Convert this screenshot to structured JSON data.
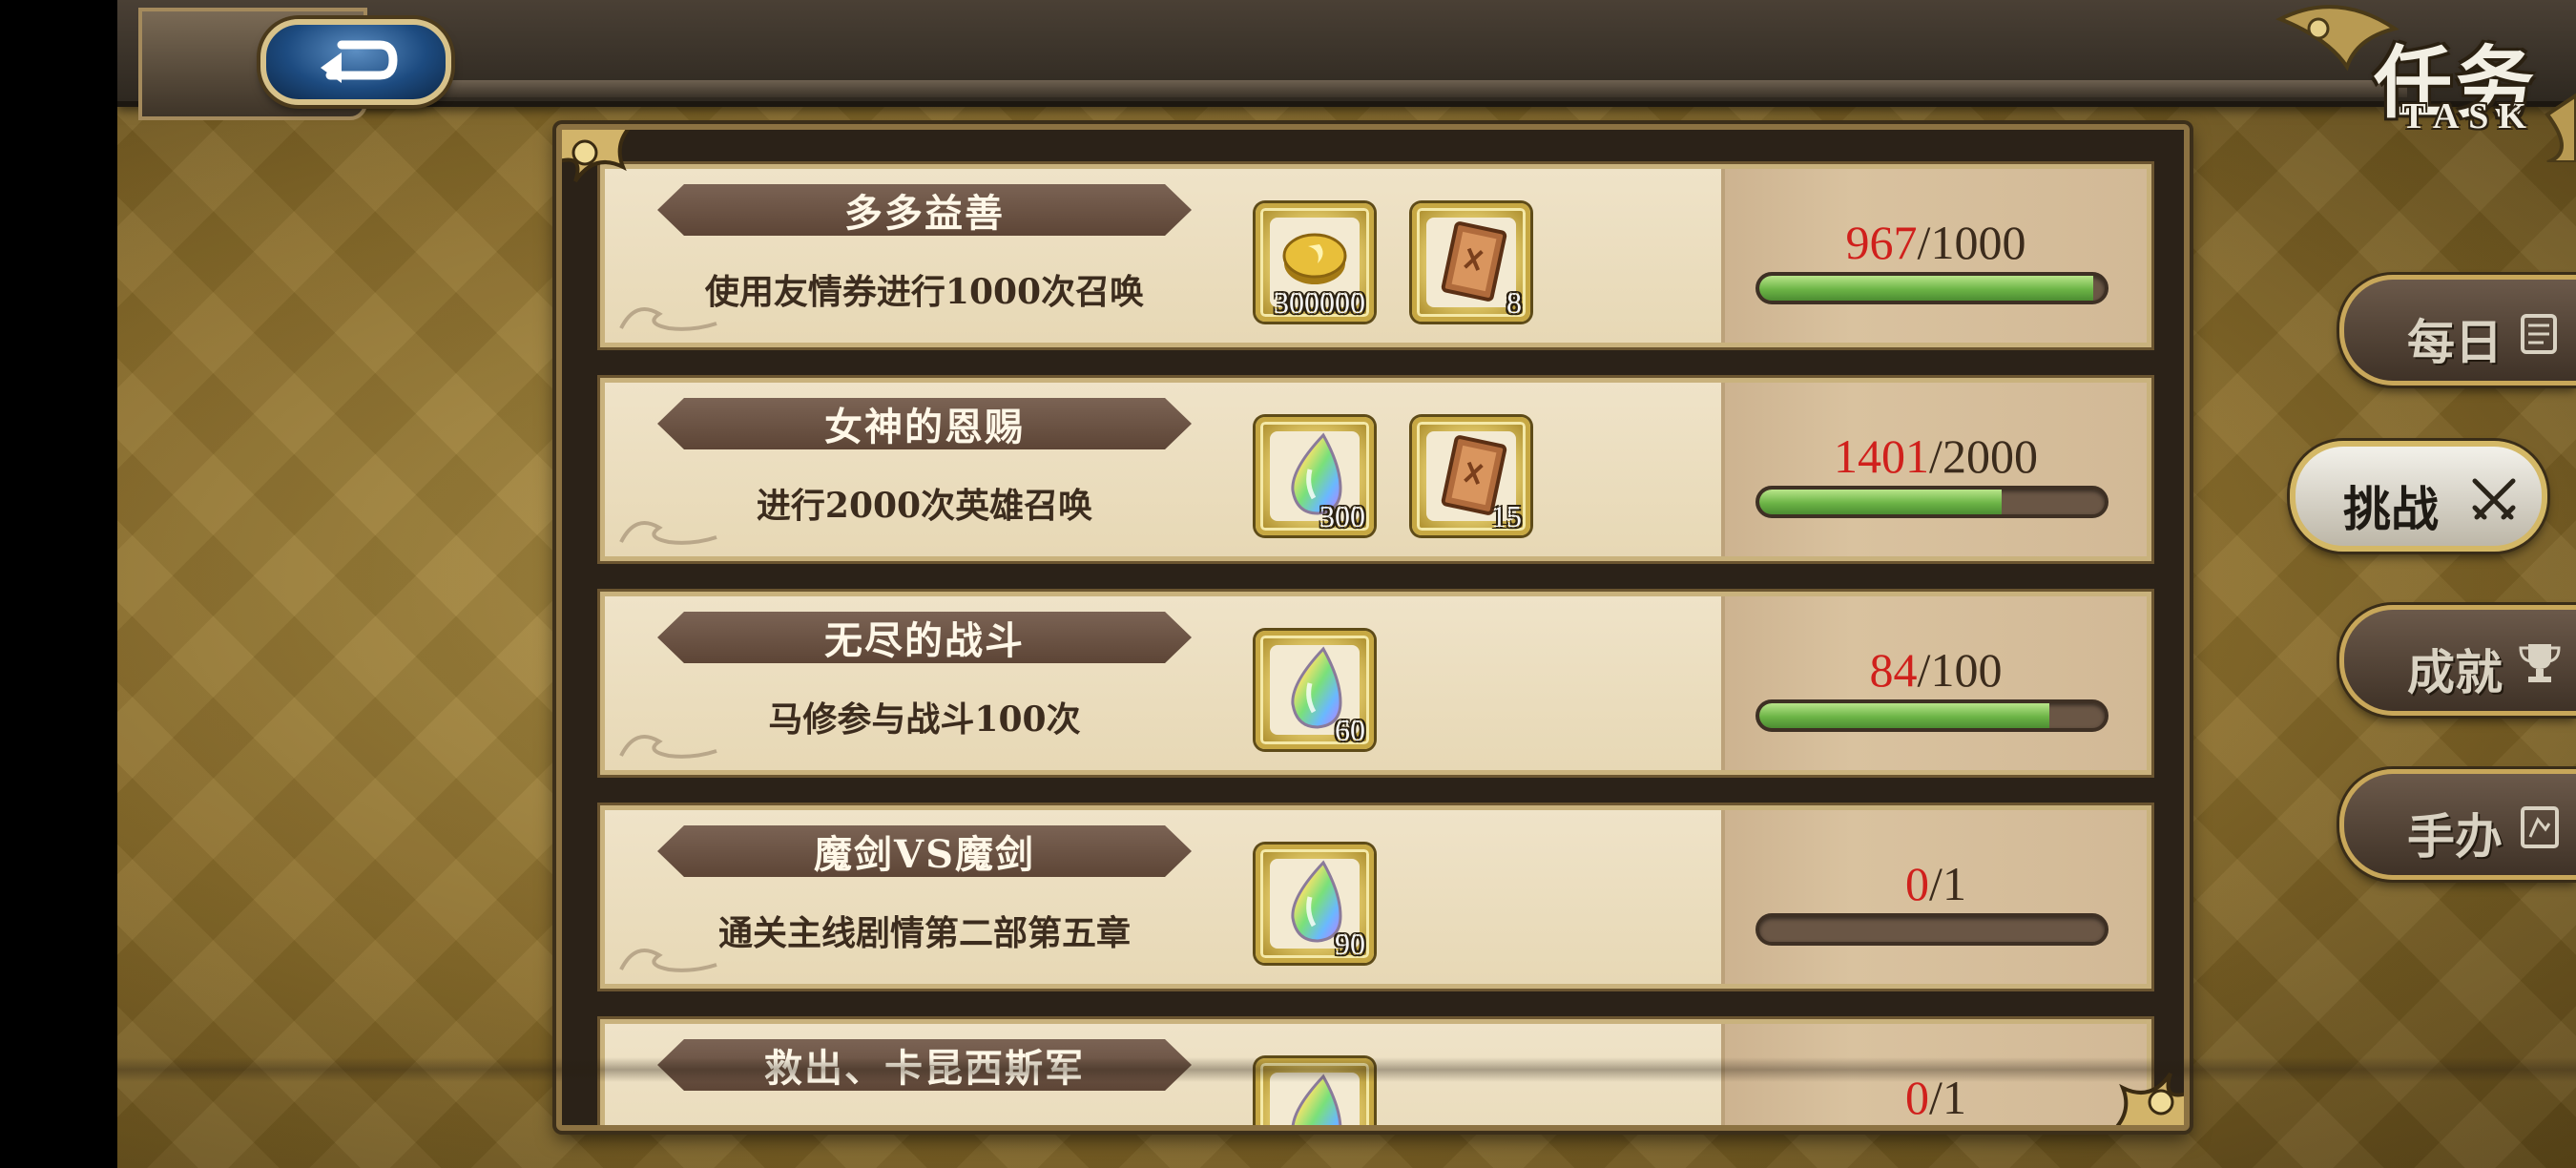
{
  "header": {
    "title": "任务",
    "subtitle": "TASK"
  },
  "tasks": [
    {
      "name": "多多益善",
      "description": "使用友情券进行1000次召唤",
      "current": "967",
      "total": "/1000",
      "progress": 0.967,
      "rewards": [
        {
          "icon": "gold-coin-icon",
          "count": "300000"
        },
        {
          "icon": "summon-ticket-icon",
          "count": "8"
        }
      ]
    },
    {
      "name": "女神的恩赐",
      "description": "进行2000次英雄召唤",
      "current": "1401",
      "total": "/2000",
      "progress": 0.7005,
      "rewards": [
        {
          "icon": "rainbow-crystal-icon",
          "count": "300"
        },
        {
          "icon": "summon-ticket-icon",
          "count": "15"
        }
      ]
    },
    {
      "name": "无尽的战斗",
      "description": "马修参与战斗100次",
      "current": "84",
      "total": "/100",
      "progress": 0.84,
      "rewards": [
        {
          "icon": "rainbow-crystal-icon",
          "count": "60"
        }
      ]
    },
    {
      "name": "魔剑VS魔剑",
      "description": "通关主线剧情第二部第五章",
      "current": "0",
      "total": "/1",
      "progress": 0,
      "rewards": [
        {
          "icon": "rainbow-crystal-icon",
          "count": "90"
        }
      ]
    },
    {
      "name": "救出、卡昆西斯军",
      "description": "",
      "current": "0",
      "total": "/1",
      "progress": 0,
      "rewards": [
        {
          "icon": "rainbow-crystal-icon",
          "count": ""
        }
      ]
    }
  ],
  "side_tabs": [
    {
      "label": "每日",
      "icon": "scroll-icon",
      "active": false
    },
    {
      "label": "挑战",
      "icon": "crossed-swords-icon",
      "active": true
    },
    {
      "label": "成就",
      "icon": "trophy-icon",
      "active": false
    },
    {
      "label": "手办",
      "icon": "figure-card-icon",
      "active": false
    }
  ],
  "colors": {
    "progress_current": "#d0201c",
    "bar_fill": "#6cb446",
    "banner": "#6b5344",
    "frame_gold": "#c8a75a"
  }
}
